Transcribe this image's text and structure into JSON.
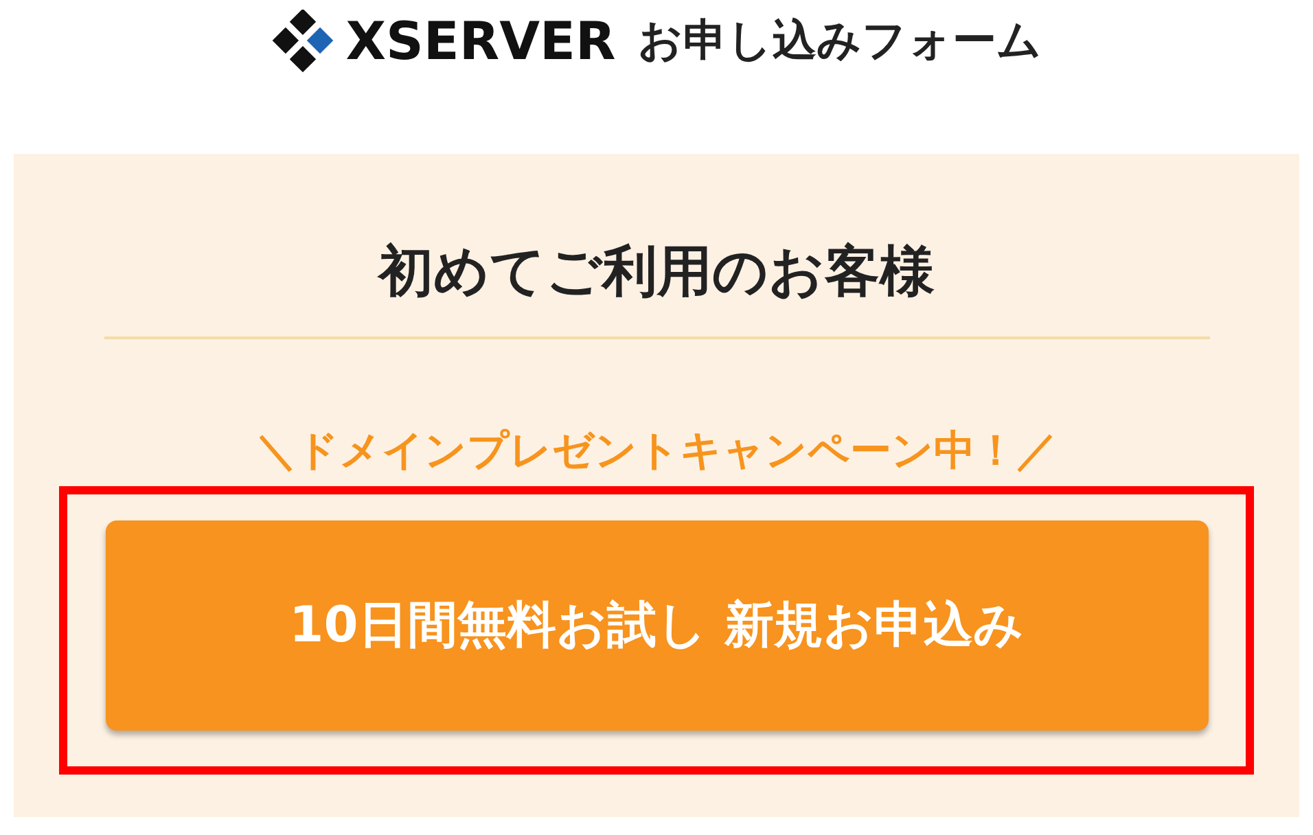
{
  "header": {
    "logo_text": "XSERVER",
    "title": "お申し込みフォーム"
  },
  "panel": {
    "heading": "初めてご利用のお客様",
    "campaign": "＼ドメインプレゼントキャンペーン中！／",
    "button": {
      "label": "10日間無料お試し 新規お申込み",
      "highlighted": true
    }
  }
}
